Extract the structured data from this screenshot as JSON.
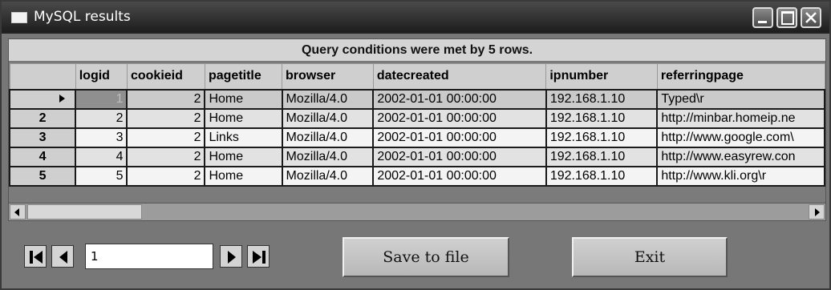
{
  "window": {
    "title": "MySQL results"
  },
  "grid": {
    "condition_message": "Query conditions were met by 5 rows.",
    "columns": [
      "logid",
      "cookieid",
      "pagetitle",
      "browser",
      "datecreated",
      "ipnumber",
      "referringpage"
    ],
    "rows": [
      {
        "header": "",
        "selected": true,
        "cells": [
          "1",
          "2",
          "Home",
          "Mozilla/4.0",
          "2002-01-01 00:00:00",
          "192.168.1.10",
          "Typed\\r"
        ]
      },
      {
        "header": "2",
        "selected": false,
        "cells": [
          "2",
          "2",
          "Home",
          "Mozilla/4.0",
          "2002-01-01 00:00:00",
          "192.168.1.10",
          "http://minbar.homeip.ne"
        ]
      },
      {
        "header": "3",
        "selected": false,
        "cells": [
          "3",
          "2",
          "Links",
          "Mozilla/4.0",
          "2002-01-01 00:00:00",
          "192.168.1.10",
          "http://www.google.com\\"
        ]
      },
      {
        "header": "4",
        "selected": false,
        "cells": [
          "4",
          "2",
          "Home",
          "Mozilla/4.0",
          "2002-01-01 00:00:00",
          "192.168.1.10",
          "http://www.easyrew.con"
        ]
      },
      {
        "header": "5",
        "selected": false,
        "cells": [
          "5",
          "2",
          "Home",
          "Mozilla/4.0",
          "2002-01-01 00:00:00",
          "192.168.1.10",
          "http://www.kli.org\\r"
        ]
      }
    ],
    "numeric_columns": [
      0,
      1
    ]
  },
  "navigator": {
    "page_value": "1"
  },
  "buttons": {
    "save_label": "Save to file",
    "exit_label": "Exit"
  },
  "icons": {
    "window": "window-icon",
    "minimize": "minimize-icon",
    "maximize": "maximize-icon",
    "close": "close-icon",
    "first": "first-record-icon",
    "prev": "previous-record-icon",
    "next": "next-record-icon",
    "last": "last-record-icon"
  },
  "colors": {
    "title_bar": "#2e2e2e",
    "header_bg": "#cfcfcf",
    "selected_cell": "#8f8f8f"
  }
}
